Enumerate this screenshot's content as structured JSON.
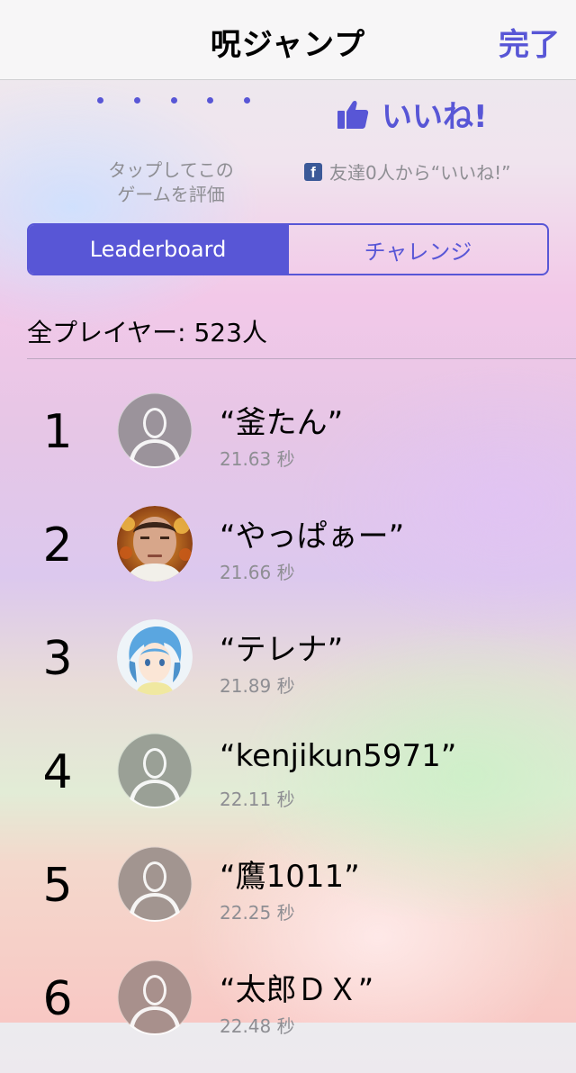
{
  "nav": {
    "title": "呪ジャンプ",
    "done_label": "完了"
  },
  "rating": {
    "dots_icon": "rating-dots-icon",
    "label_line1": "タップしてこの",
    "label_line2": "ゲームを評価"
  },
  "like": {
    "icon": "thumbs-up-icon",
    "label": "いいね!",
    "friends_icon": "facebook-icon",
    "friends_text": "友達0人から“いいね!”"
  },
  "tabs": [
    {
      "label": "Leaderboard",
      "selected": true
    },
    {
      "label": "チャレンジ",
      "selected": false
    }
  ],
  "player_count": "全プレイヤー: 523人",
  "colors": {
    "accent": "#5856d6",
    "secondary_text": "#8e8e93"
  },
  "leaderboard": [
    {
      "rank": "1",
      "name": "“釜たん”",
      "score": "21.63 秒",
      "avatar": "default-silhouette-icon"
    },
    {
      "rank": "2",
      "name": "“やっぱぁー”",
      "score": "21.66 秒",
      "avatar": "photo-avatar"
    },
    {
      "rank": "3",
      "name": "“テレナ”",
      "score": "21.89 秒",
      "avatar": "anime-avatar"
    },
    {
      "rank": "4",
      "name": "“kenjikun5971”",
      "score": "22.11 秒",
      "avatar": "default-silhouette-icon"
    },
    {
      "rank": "5",
      "name": "“鷹1011”",
      "score": "22.25 秒",
      "avatar": "default-silhouette-icon"
    },
    {
      "rank": "6",
      "name": "“太郎ＤＸ”",
      "score": "22.48 秒",
      "avatar": "default-silhouette-icon"
    }
  ]
}
